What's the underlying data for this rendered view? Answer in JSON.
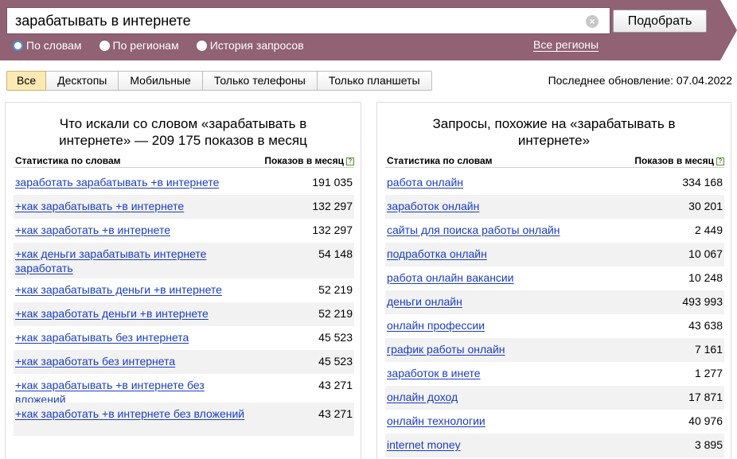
{
  "search": {
    "query": "зарабатывать в интернете",
    "clear_icon": "clear-icon",
    "submit_label": "Подобрать"
  },
  "modes": [
    {
      "label": "По словам",
      "selected": true
    },
    {
      "label": "По регионам",
      "selected": false
    },
    {
      "label": "История запросов",
      "selected": false
    }
  ],
  "regions_link": "Все регионы",
  "device_tabs": [
    "Все",
    "Десктопы",
    "Мобильные",
    "Только телефоны",
    "Только планшеты"
  ],
  "active_device_tab": "Все",
  "last_update": "Последнее обновление: 07.04.2022",
  "colors": {
    "banner": "#916174",
    "link": "#1a3dc1",
    "active_tab": "#fde9b4",
    "row_stripe": "#f2f2f2"
  },
  "left_panel": {
    "title": "Что искали со словом «зарабатывать в интернете» — 209 175 показов в месяц",
    "col_left": "Статистика по словам",
    "col_right": "Показов в месяц",
    "rows": [
      {
        "q": "заработать зарабатывать +в интернете",
        "n": "191 035"
      },
      {
        "q": "+как зарабатывать +в интернете",
        "n": "132 297"
      },
      {
        "q": "+как заработать +в интернете",
        "n": "132 297"
      },
      {
        "q": "+как деньги зарабатывать интернете заработать",
        "n": "54 148"
      },
      {
        "q": "+как зарабатывать деньги +в интернете",
        "n": "52 219"
      },
      {
        "q": "+как заработать деньги +в интернете",
        "n": "52 219"
      },
      {
        "q": "+как зарабатывать без интернета",
        "n": "45 523"
      },
      {
        "q": "+как заработать без интернета",
        "n": "45 523"
      },
      {
        "q": "+как зарабатывать +в интернете без вложений",
        "n": "43 271"
      },
      {
        "q": "+как заработать +в интернете без вложений",
        "n": "43 271"
      }
    ]
  },
  "right_panel": {
    "title": "Запросы, похожие на «зарабатывать в интернете»",
    "col_left": "Статистика по словам",
    "col_right": "Показов в месяц",
    "rows": [
      {
        "q": "работа онлайн",
        "n": "334 168"
      },
      {
        "q": "заработок онлайн",
        "n": "30 201"
      },
      {
        "q": "сайты для поиска работы онлайн",
        "n": "2 449"
      },
      {
        "q": "подработка онлайн",
        "n": "10 067"
      },
      {
        "q": "работа онлайн вакансии",
        "n": "10 248"
      },
      {
        "q": "деньги онлайн",
        "n": "493 993"
      },
      {
        "q": "онлайн профессии",
        "n": "43 638"
      },
      {
        "q": "график работы онлайн",
        "n": "7 161"
      },
      {
        "q": "заработок в инете",
        "n": "1 277"
      },
      {
        "q": "онлайн доход",
        "n": "17 871"
      },
      {
        "q": "онлайн технологии",
        "n": "40 976"
      },
      {
        "q": "internet money",
        "n": "3 895"
      }
    ]
  }
}
